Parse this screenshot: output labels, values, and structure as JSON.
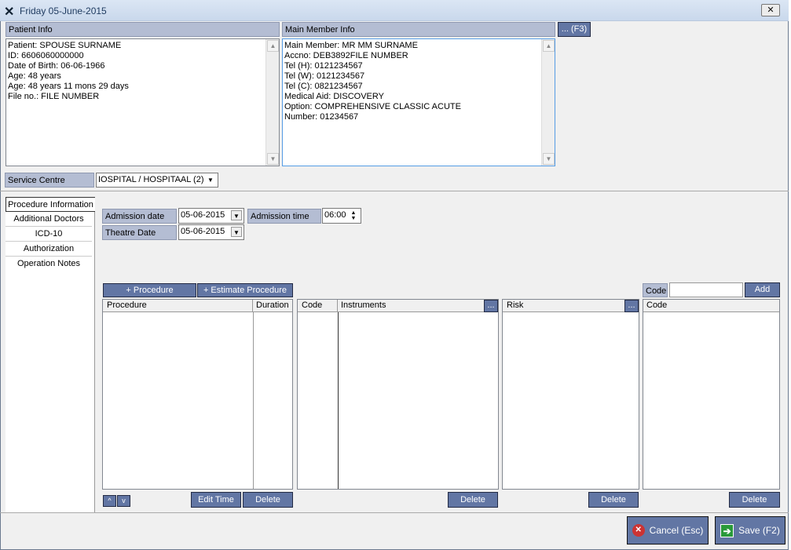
{
  "window": {
    "title": "Friday 05-June-2015",
    "close": "✕"
  },
  "patient": {
    "header": "Patient Info",
    "lines": [
      "Patient: SPOUSE SURNAME",
      "ID: 6606060000000",
      "Date of Birth: 06-06-1966",
      "Age: 48 years",
      "Age: 48 years 11 mons 29 days",
      "File no.: FILE NUMBER"
    ]
  },
  "member": {
    "header": "Main Member Info",
    "button": "... (F3)",
    "lines": [
      "Main Member: MR MM SURNAME",
      "Accno: DEB3892FILE NUMBER",
      "Tel (H): 0121234567",
      "Tel (W): 0121234567",
      "Tel (C): 0821234567",
      "Medical Aid: DISCOVERY",
      "Option: COMPREHENSIVE CLASSIC ACUTE",
      "Number: 01234567"
    ]
  },
  "service": {
    "label": "Service Centre",
    "value": "IOSPITAL / HOSPITAAL (2)"
  },
  "tabs": [
    "Procedure Information",
    "Additional Doctors",
    "ICD-10",
    "Authorization",
    "Operation Notes"
  ],
  "form": {
    "admission_date_label": "Admission date",
    "admission_date": "05-06-2015",
    "admission_time_label": "Admission time",
    "admission_time": "06:00",
    "theatre_date_label": "Theatre Date",
    "theatre_date": "05-06-2015"
  },
  "procedures": {
    "add": "+ Procedure",
    "estimate": "+ Estimate Procedure",
    "col_procedure": "Procedure",
    "col_duration": "Duration",
    "up": "^",
    "down": "v",
    "edit_time": "Edit Time",
    "delete": "Delete"
  },
  "instruments": {
    "col_code": "Code",
    "col_instruments": "Instruments",
    "more": "...",
    "delete": "Delete"
  },
  "risk": {
    "col_risk": "Risk",
    "more": "...",
    "delete": "Delete"
  },
  "codes": {
    "label": "Code",
    "input": "",
    "add": "Add",
    "col_code": "Code",
    "delete": "Delete"
  },
  "footer": {
    "cancel": "Cancel (Esc)",
    "save": "Save (F2)"
  }
}
